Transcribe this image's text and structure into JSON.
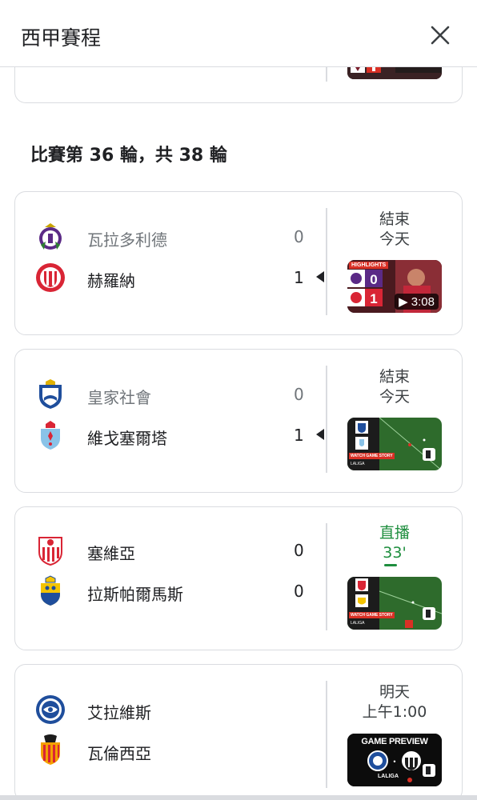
{
  "header": {
    "title": "西甲賽程"
  },
  "round_title": "比賽第 36 輪，共 38 輪",
  "matches": [
    {
      "home": {
        "name": "瓦拉多利德",
        "score": "0",
        "result": "loss"
      },
      "away": {
        "name": "赫羅納",
        "score": "1",
        "result": "win"
      },
      "status_line1": "結束",
      "status_line2": "今天",
      "video": {
        "type": "highlights",
        "label": "HIGHLIGHTS",
        "score_home": "0",
        "score_away": "1",
        "duration": "3:08"
      }
    },
    {
      "home": {
        "name": "皇家社會",
        "score": "0",
        "result": "loss"
      },
      "away": {
        "name": "維戈塞爾塔",
        "score": "1",
        "result": "win"
      },
      "status_line1": "結束",
      "status_line2": "今天",
      "video": {
        "type": "story",
        "label": "WATCH GAME STORY",
        "brand": "LALIGA"
      }
    },
    {
      "home": {
        "name": "塞維亞",
        "score": "0",
        "result": "draw"
      },
      "away": {
        "name": "拉斯帕爾馬斯",
        "score": "0",
        "result": "draw"
      },
      "status_line1": "直播",
      "status_line2": "33'",
      "live": true,
      "video": {
        "type": "story",
        "label": "WATCH GAME STORY",
        "brand": "LALIGA"
      }
    },
    {
      "home": {
        "name": "艾拉維斯",
        "score": "",
        "result": "upcoming"
      },
      "away": {
        "name": "瓦倫西亞",
        "score": "",
        "result": "upcoming"
      },
      "status_line1": "明天",
      "status_line2": "上午1:00",
      "video": {
        "type": "preview",
        "label": "GAME PREVIEW",
        "brand": "LALIGA"
      }
    }
  ],
  "colors": {
    "live_green": "#1e8e3e",
    "divider": "#dadce0",
    "text_primary": "#202124",
    "text_secondary": "#70757a",
    "laliga_red": "#d93025"
  },
  "icons": [
    "close-icon",
    "valladolid-crest-icon",
    "girona-crest-icon",
    "real-sociedad-crest-icon",
    "celta-crest-icon",
    "sevilla-crest-icon",
    "las-palmas-crest-icon",
    "alaves-crest-icon",
    "valencia-crest-icon",
    "play-icon",
    "story-icon"
  ]
}
